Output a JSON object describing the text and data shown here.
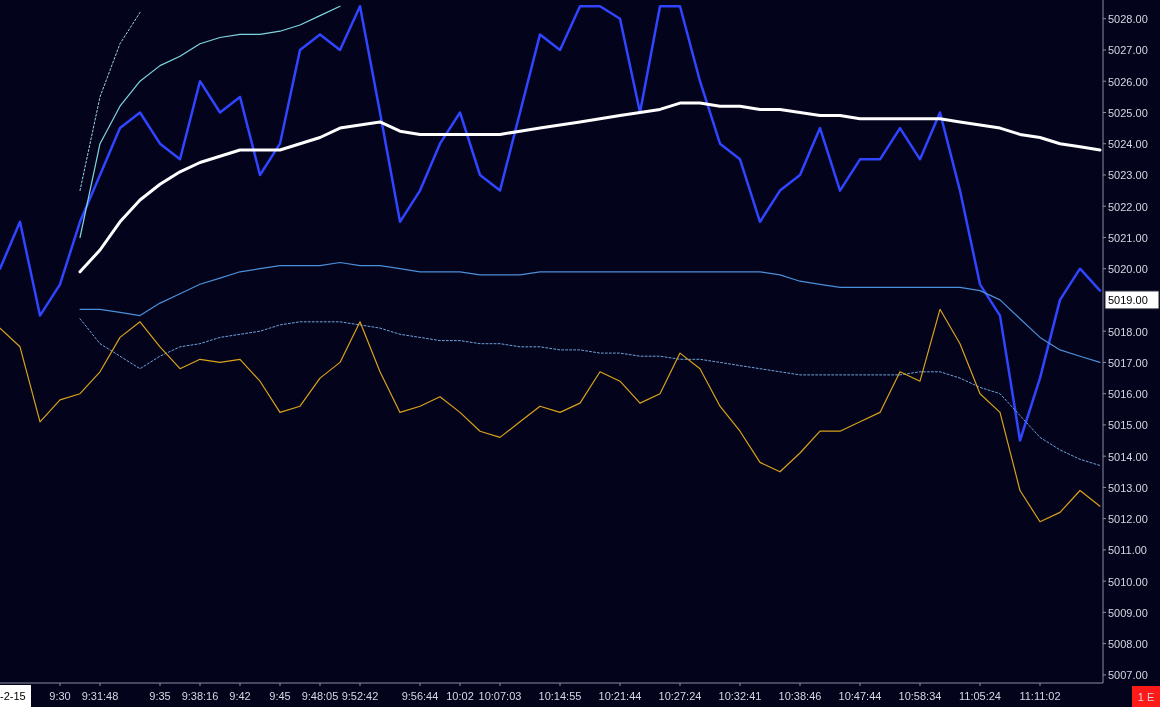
{
  "chart": {
    "date_box": "-2-15",
    "status_badge": "1 E",
    "last_price": "5019.00",
    "chart_data": {
      "type": "line",
      "categories": [
        null,
        null,
        null,
        "9:30",
        null,
        "9:31:48",
        null,
        null,
        "9:35",
        null,
        "9:38:16",
        null,
        "9:42",
        null,
        "9:45",
        null,
        "9:48:05",
        null,
        "9:52:42",
        null,
        null,
        "9:56:44",
        null,
        "10:02",
        null,
        "10:07:03",
        null,
        null,
        "10:14:55",
        null,
        null,
        "10:21:44",
        null,
        null,
        "10:27:24",
        null,
        null,
        "10:32:41",
        null,
        null,
        "10:38:46",
        null,
        null,
        "10:47:44",
        null,
        null,
        "10:58:34",
        null,
        null,
        "11:05:24",
        null,
        null,
        "11:11:02",
        null,
        null,
        null
      ],
      "ylim": [
        5006.74,
        5028.6
      ],
      "yticks": [
        {
          "value": 5028,
          "label": "5028.00"
        },
        {
          "value": 5027,
          "label": "5027.00"
        },
        {
          "value": 5026,
          "label": "5026.00"
        },
        {
          "value": 5025,
          "label": "5025.00"
        },
        {
          "value": 5024,
          "label": "5024.00"
        },
        {
          "value": 5023,
          "label": "5023.00"
        },
        {
          "value": 5022,
          "label": "5022.00"
        },
        {
          "value": 5021,
          "label": "5021.00"
        },
        {
          "value": 5020,
          "label": "5020.00"
        },
        {
          "value": 5018,
          "label": "5018.00"
        },
        {
          "value": 5017,
          "label": "5017.00"
        },
        {
          "value": 5016,
          "label": "5016.00"
        },
        {
          "value": 5015,
          "label": "5015.00"
        },
        {
          "value": 5014,
          "label": "5014.00"
        },
        {
          "value": 5013,
          "label": "5013.00"
        },
        {
          "value": 5012,
          "label": "5012.00"
        },
        {
          "value": 5011,
          "label": "5011.00"
        },
        {
          "value": 5010,
          "label": "5010.00"
        },
        {
          "value": 5009,
          "label": "5009.00"
        },
        {
          "value": 5008,
          "label": "5008.00"
        },
        {
          "value": 5007,
          "label": "5007.00"
        }
      ],
      "series": [
        {
          "color": "#2f45ff",
          "line_style": "solid",
          "values": [
            5020,
            5021.5,
            5018.5,
            5019.5,
            5021.5,
            5023,
            5024.5,
            5025,
            5024,
            5023.5,
            5026,
            5025,
            5025.5,
            5023,
            5024,
            5027,
            5027.5,
            5027,
            5028.4,
            5025,
            5021.5,
            5022.5,
            5024,
            5025,
            5023,
            5022.5,
            5025,
            5027.5,
            5027,
            5028.4,
            5028.4,
            5028,
            5025,
            5028.4,
            5028.4,
            5026,
            5024,
            5023.5,
            5021.5,
            5022.5,
            5023,
            5024.5,
            5022.5,
            5023.5,
            5023.5,
            5024.5,
            5023.5,
            5025,
            5022.5,
            5019.5,
            5018.5,
            5014.5,
            5016.5,
            5019,
            5020,
            5019.3
          ]
        },
        {
          "color": "#ffffff",
          "line_style": "solid",
          "values": [
            null,
            null,
            null,
            null,
            5019.9,
            5020.6,
            5021.5,
            5022.2,
            5022.7,
            5023.1,
            5023.4,
            5023.6,
            5023.8,
            5023.8,
            5023.8,
            5024,
            5024.2,
            5024.5,
            5024.6,
            5024.7,
            5024.4,
            5024.3,
            5024.3,
            5024.3,
            5024.3,
            5024.3,
            5024.4,
            5024.5,
            5024.6,
            5024.7,
            5024.8,
            5024.9,
            5025,
            5025.1,
            5025.3,
            5025.3,
            5025.2,
            5025.2,
            5025.1,
            5025.1,
            5025,
            5024.9,
            5024.9,
            5024.8,
            5024.8,
            5024.8,
            5024.8,
            5024.8,
            5024.7,
            5024.6,
            5024.5,
            5024.3,
            5024.2,
            5024,
            5023.9,
            5023.8
          ]
        },
        {
          "color": "#4a8fd8",
          "line_style": "solid",
          "values": [
            null,
            null,
            null,
            null,
            5018.7,
            5018.7,
            5018.6,
            5018.5,
            5018.9,
            5019.2,
            5019.5,
            5019.7,
            5019.9,
            5020,
            5020.1,
            5020.1,
            5020.1,
            5020.2,
            5020.1,
            5020.1,
            5020,
            5019.9,
            5019.9,
            5019.9,
            5019.8,
            5019.8,
            5019.8,
            5019.9,
            5019.9,
            5019.9,
            5019.9,
            5019.9,
            5019.9,
            5019.9,
            5019.9,
            5019.9,
            5019.9,
            5019.9,
            5019.9,
            5019.8,
            5019.6,
            5019.5,
            5019.4,
            5019.4,
            5019.4,
            5019.4,
            5019.4,
            5019.4,
            5019.4,
            5019.3,
            5019,
            5018.4,
            5017.8,
            5017.4,
            5017.2,
            5017
          ]
        },
        {
          "color": "#6fa3d8",
          "line_style": "dotted",
          "values": [
            null,
            null,
            null,
            null,
            5018.4,
            5017.6,
            5017.2,
            5016.8,
            5017.2,
            5017.5,
            5017.6,
            5017.8,
            5017.9,
            5018,
            5018.2,
            5018.3,
            5018.3,
            5018.3,
            5018.2,
            5018.1,
            5017.9,
            5017.8,
            5017.7,
            5017.7,
            5017.6,
            5017.6,
            5017.5,
            5017.5,
            5017.4,
            5017.4,
            5017.3,
            5017.3,
            5017.2,
            5017.2,
            5017.1,
            5017.1,
            5017,
            5016.9,
            5016.8,
            5016.7,
            5016.6,
            5016.6,
            5016.6,
            5016.6,
            5016.6,
            5016.6,
            5016.7,
            5016.7,
            5016.5,
            5016.2,
            5016,
            5015.3,
            5014.6,
            5014.2,
            5013.9,
            5013.7
          ]
        },
        {
          "color": "#7fd6e0",
          "line_style": "solid",
          "values": [
            null,
            null,
            null,
            null,
            5021,
            5024,
            5025.2,
            5026,
            5026.5,
            5026.8,
            5027.2,
            5027.4,
            5027.5,
            5027.5,
            5027.6,
            5027.8,
            5028.1,
            5028.4,
            null,
            null,
            null,
            null,
            null,
            null,
            null,
            null,
            null,
            null,
            null,
            null,
            null,
            null,
            null,
            null,
            null,
            null,
            null,
            null,
            null,
            null,
            null,
            null,
            null,
            null,
            null,
            null,
            null,
            null,
            null,
            null,
            null,
            null,
            null,
            null,
            null,
            null
          ]
        },
        {
          "color": "#9fd0e8",
          "line_style": "dotted",
          "values": [
            null,
            null,
            null,
            null,
            5022.5,
            5025.5,
            5027.2,
            5028.2,
            null,
            null,
            null,
            null,
            null,
            null,
            null,
            null,
            null,
            null,
            null,
            null,
            null,
            null,
            null,
            null,
            null,
            null,
            null,
            null,
            null,
            null,
            null,
            null,
            null,
            null,
            null,
            null,
            null,
            null,
            null,
            null,
            null,
            null,
            null,
            null,
            null,
            null,
            null,
            null,
            null,
            null,
            null,
            null,
            null,
            null,
            null,
            null
          ]
        },
        {
          "color": "#d9a21b",
          "line_style": "solid",
          "values": [
            5018.1,
            5017.5,
            5015.1,
            5015.8,
            5016,
            5016.7,
            5017.8,
            5018.3,
            5017.5,
            5016.8,
            5017.1,
            5017,
            5017.1,
            5016.4,
            5015.4,
            5015.6,
            5016.5,
            5017,
            5018.3,
            5016.7,
            5015.4,
            5015.6,
            5015.9,
            5015.4,
            5014.8,
            5014.6,
            5015.1,
            5015.6,
            5015.4,
            5015.7,
            5016.7,
            5016.4,
            5015.7,
            5016,
            5017.3,
            5016.8,
            5015.6,
            5014.8,
            5013.8,
            5013.5,
            5014.1,
            5014.8,
            5014.8,
            5015.1,
            5015.4,
            5016.7,
            5016.4,
            5018.7,
            5017.6,
            5016,
            5015.4,
            5012.9,
            5011.9,
            5012.2,
            5012.9,
            5012.4
          ]
        }
      ]
    }
  }
}
